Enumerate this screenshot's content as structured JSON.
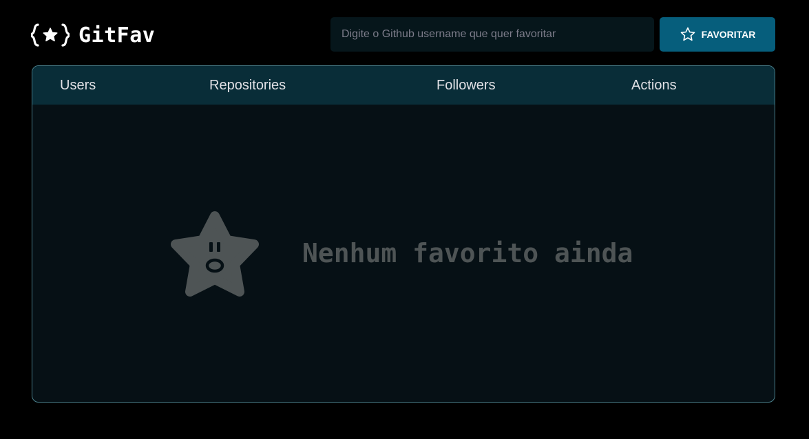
{
  "header": {
    "app_name": "GitFav",
    "logo_icon": "braces-star-icon",
    "search": {
      "placeholder": "Digite o Github username que quer favoritar",
      "value": ""
    },
    "favorite_button": {
      "label": "FAVORITAR",
      "icon": "star-outline-icon"
    }
  },
  "table": {
    "columns": [
      "Users",
      "Repositories",
      "Followers",
      "Actions"
    ],
    "rows": [],
    "empty_state": {
      "icon": "surprised-star-icon",
      "message": "Nenhum favorito ainda"
    }
  },
  "colors": {
    "background": "#000000",
    "accent": "#065e7c",
    "header_row": "#092d38",
    "panel_bg": "#061015",
    "panel_border": "#4a808c",
    "input_bg": "#06161b",
    "empty_text": "#4e5455",
    "empty_icon": "#4e5455"
  }
}
